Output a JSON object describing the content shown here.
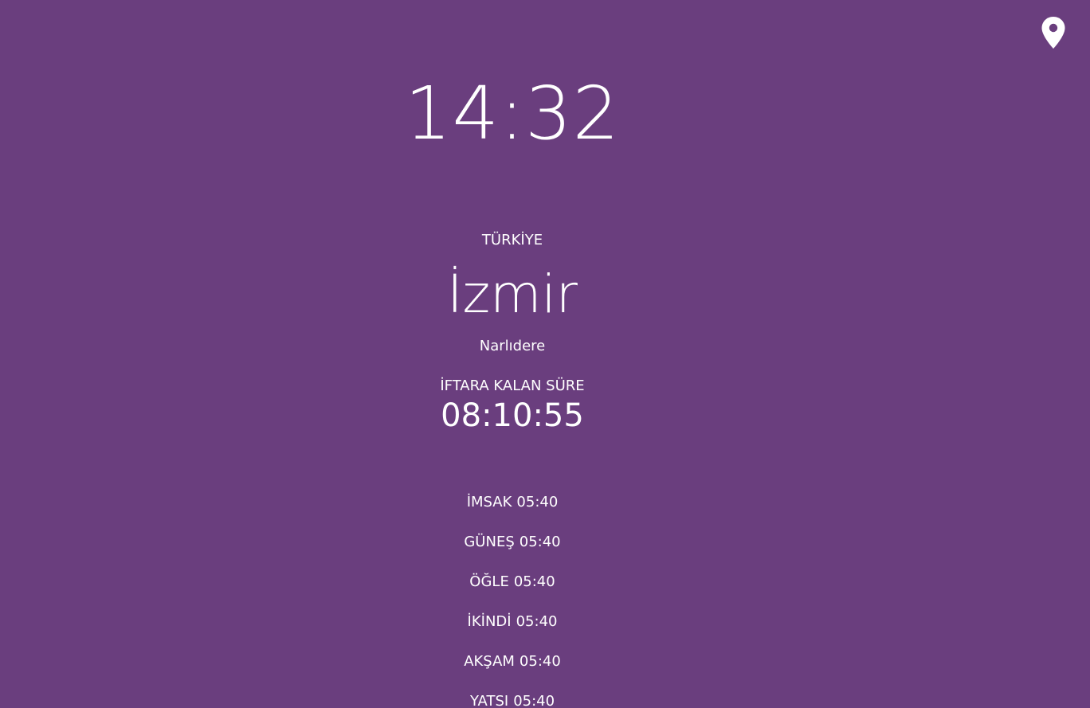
{
  "header": {
    "location_icon": "map-marker-icon"
  },
  "clock": {
    "time": "14:32"
  },
  "location": {
    "country": "TÜRKİYE",
    "city": "İzmir",
    "district": "Narlıdere"
  },
  "countdown": {
    "label": "İFTARA KALAN SÜRE",
    "value": "08:10:55"
  },
  "prayer_times": [
    {
      "name": "İMSAK",
      "time": "05:40"
    },
    {
      "name": "GÜNEŞ",
      "time": "05:40"
    },
    {
      "name": "ÖĞLE",
      "time": "05:40"
    },
    {
      "name": "İKİNDİ",
      "time": "05:40"
    },
    {
      "name": "AKŞAM",
      "time": "05:40"
    },
    {
      "name": "YATSI",
      "time": "05:40"
    }
  ],
  "colors": {
    "background": "#6a3e7e",
    "text": "#ffffff"
  }
}
